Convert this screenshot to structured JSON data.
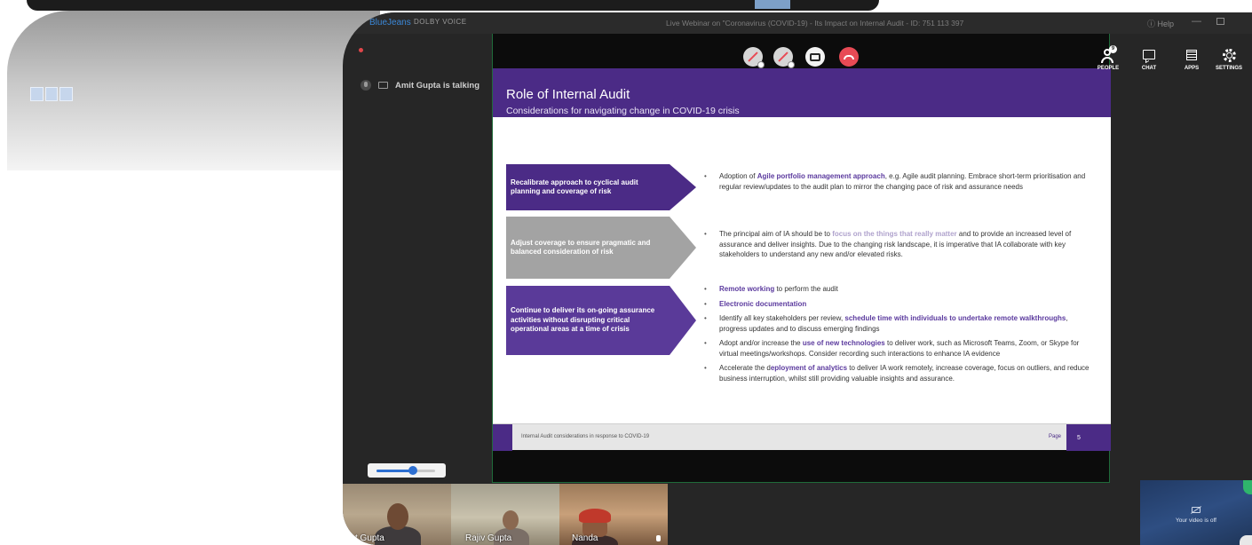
{
  "window": {
    "brand": "BlueJeans",
    "dolby": "DOLBY VOICE",
    "title": "Live Webinar on \"Coronavirus (COVID-19) - Its Impact on Internal Audit - ID: 751 113 397",
    "help": "Help",
    "minimize": "—"
  },
  "status": {
    "talking": "Amit Gupta is talking"
  },
  "menu": {
    "people": "PEOPLE",
    "people_count": "9",
    "chat": "CHAT",
    "apps": "APPS",
    "settings": "SETTINGS"
  },
  "slide": {
    "title": "Role of Internal Audit",
    "subtitle": "Considerations for navigating change in COVID-19 crisis",
    "chevrons": [
      "Recalibrate approach to cyclical audit planning and coverage of risk",
      "Adjust coverage to ensure pragmatic and balanced consideration of risk",
      "Continue to deliver its on-going assurance activities without disrupting critical operational areas at a time of crisis"
    ],
    "b1": {
      "pre": "Adoption of ",
      "hl": "Agile portfolio management approach",
      "post": ", e.g. Agile audit planning. Embrace short-term prioritisation and regular review/updates to the audit plan to mirror the changing pace of risk and assurance needs"
    },
    "b2": {
      "pre": "The principal aim of IA should be to ",
      "hl": "focus on the things that really matter",
      "post": " and to provide an increased level of assurance and deliver insights. Due to the changing risk landscape, it is imperative that IA collaborate with key stakeholders to understand any new and/or elevated risks."
    },
    "b3": {
      "remote_hl": "Remote working",
      "remote_post": " to perform the audit",
      "edoc": "Electronic documentation",
      "identify_pre": "Identify all key stakeholders per review, ",
      "identify_hl": "schedule time with individuals to undertake remote walkthroughs",
      "identify_post": ", progress updates and to discuss emerging findings",
      "adopt_pre": "Adopt and/or increase the ",
      "adopt_hl": "use of new technologies",
      "adopt_post": " to deliver work, such as Microsoft Teams, Zoom, or Skype for virtual meetings/workshops. Consider recording such interactions to enhance IA evidence",
      "accel_pre": "Accelerate the d",
      "accel_hl": "eployment of analytics",
      "accel_post": " to deliver IA work remotely, increase coverage, focus on outliers, and reduce business interruption, whilst still providing valuable insights and assurance."
    },
    "footer_text": "Internal Audit considerations in response to COVID-19",
    "footer_page_label": "Page",
    "footer_page_number": "5"
  },
  "volume": {
    "level": 0.62
  },
  "participants": [
    {
      "name": "t Gupta"
    },
    {
      "name": "Rajiv Gupta"
    },
    {
      "name": "Nanda"
    }
  ],
  "self_view": {
    "message": "Your video is off"
  },
  "colors": {
    "accent_purple": "#4b2b86",
    "hangup_red": "#e84a55",
    "brand_blue": "#3b88d8"
  }
}
